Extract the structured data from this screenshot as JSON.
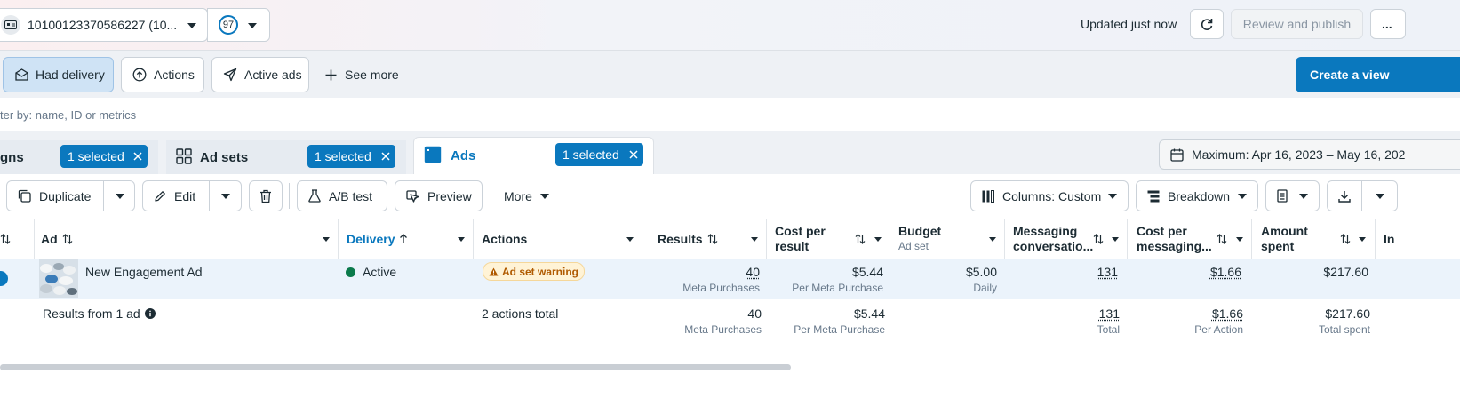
{
  "topbar": {
    "account_name": "10100123370586227 (10...",
    "score": "97",
    "updated_text": "Updated just now",
    "review_publish_label": "Review and publish",
    "more_label": "..."
  },
  "filters": {
    "had_delivery": "Had delivery",
    "actions": "Actions",
    "active_ads": "Active ads",
    "see_more": "See more",
    "create_view": "Create a view"
  },
  "search": {
    "placeholder": "ter by: name, ID or metrics"
  },
  "tabs": [
    {
      "label": "gns",
      "selected": "1 selected"
    },
    {
      "label": "Ad sets",
      "selected": "1 selected"
    },
    {
      "label": "Ads",
      "selected": "1 selected"
    }
  ],
  "date_range": "Maximum: Apr 16, 2023 – May 16, 202",
  "toolbar": {
    "duplicate": "Duplicate",
    "edit": "Edit",
    "ab_test": "A/B test",
    "preview": "Preview",
    "more": "More",
    "columns": "Columns: Custom",
    "breakdown": "Breakdown"
  },
  "table": {
    "headers": {
      "ad": "Ad",
      "delivery": "Delivery",
      "actions": "Actions",
      "results": "Results",
      "cost_per_result_1": "Cost per",
      "cost_per_result_2": "result",
      "budget": "Budget",
      "budget_sub": "Ad set",
      "messaging_1": "Messaging",
      "messaging_2": "conversatio...",
      "cost_msg_1": "Cost per",
      "cost_msg_2": "messaging...",
      "amount_1": "Amount",
      "amount_2": "spent",
      "next": "In"
    },
    "row": {
      "ad_name": "New Engagement Ad",
      "delivery": "Active",
      "warning": "Ad set warning",
      "results": "40",
      "results_sub": "Meta Purchases",
      "cost_per_result": "$5.44",
      "cost_per_result_sub": "Per Meta Purchase",
      "budget": "$5.00",
      "budget_sub": "Daily",
      "messaging": "131",
      "cost_msg": "$1.66",
      "amount": "$217.60"
    },
    "summary": {
      "label": "Results from 1 ad",
      "actions": "2 actions total",
      "results": "40",
      "results_sub": "Meta Purchases",
      "cost_per_result": "$5.44",
      "cost_per_result_sub": "Per Meta Purchase",
      "messaging": "131",
      "messaging_sub": "Total",
      "cost_msg": "$1.66",
      "cost_msg_sub": "Per Action",
      "amount": "$217.60",
      "amount_sub": "Total spent"
    }
  },
  "colors": {
    "primary": "#0a78be",
    "active_green": "#0b7a4b",
    "warning_bg": "#fff3d6",
    "warning_text": "#b05a00"
  }
}
